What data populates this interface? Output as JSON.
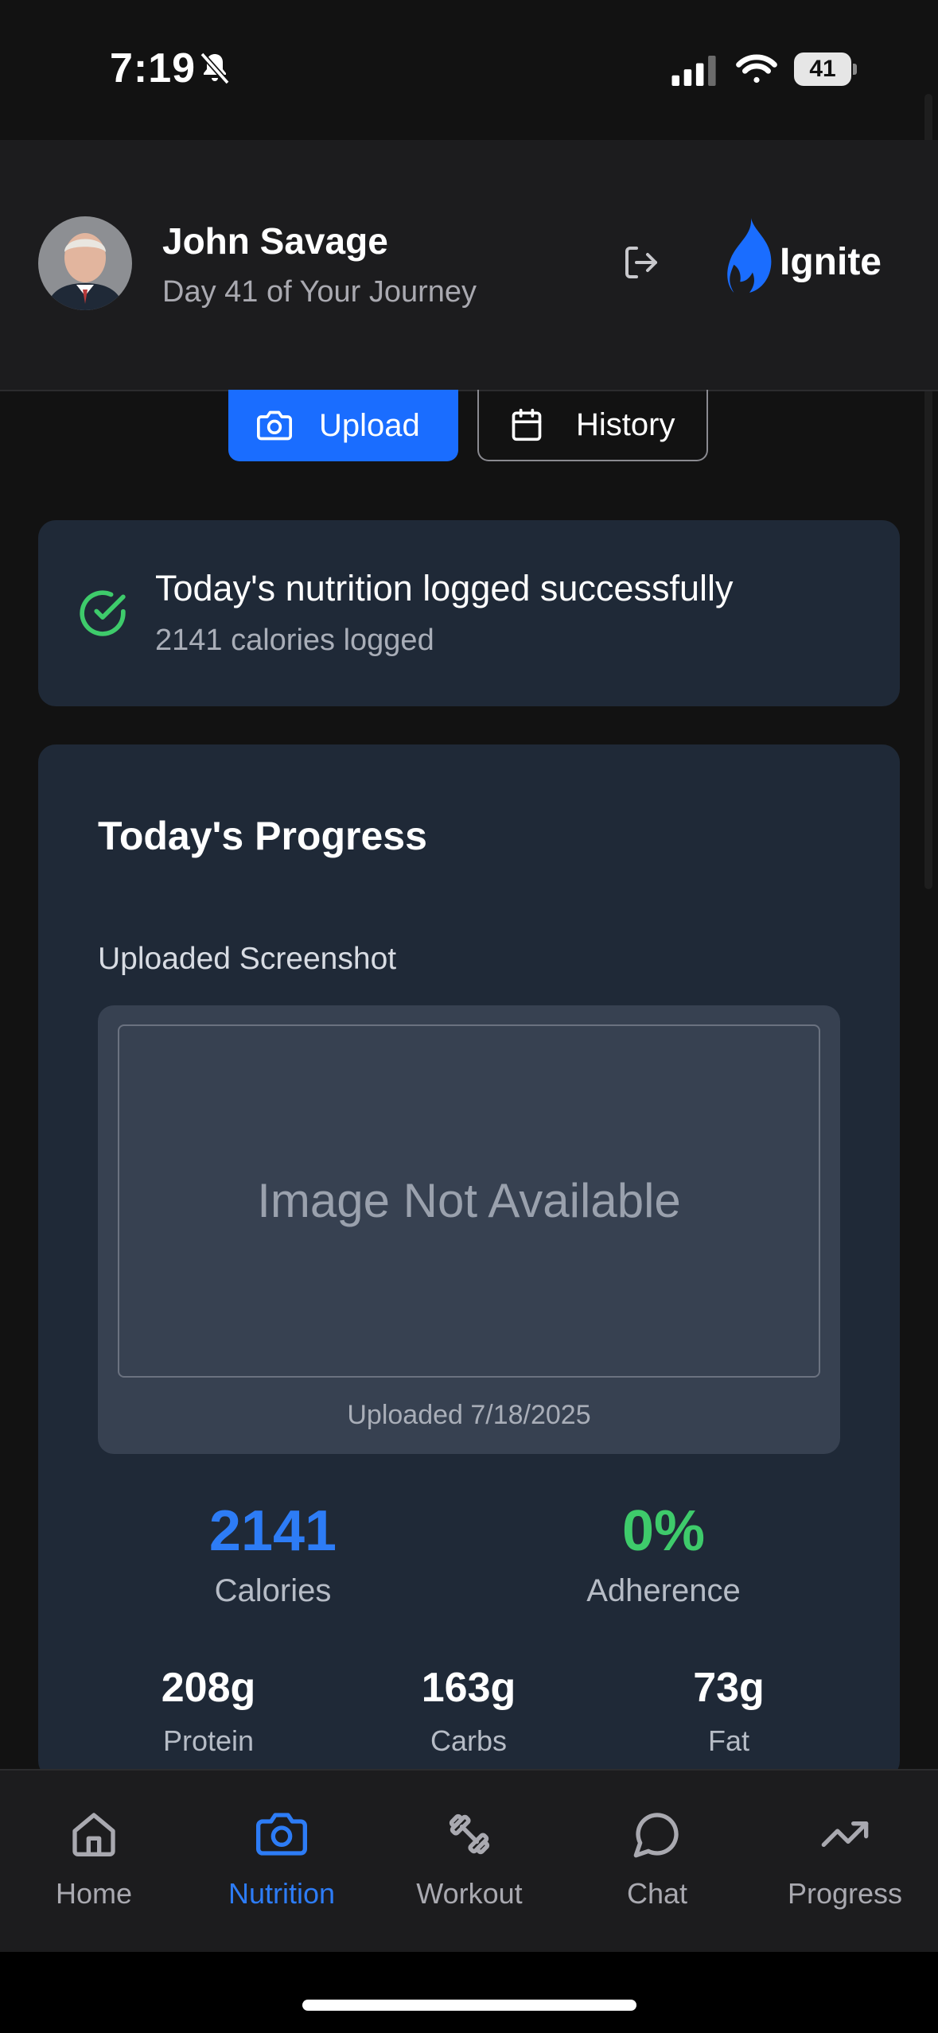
{
  "status_bar": {
    "time": "7:19",
    "battery": "41"
  },
  "header": {
    "user_name": "John Savage",
    "subtitle": "Day 41 of Your Journey",
    "brand": "Ignite",
    "brand_color": "#1a6dff"
  },
  "actions": {
    "upload_label": "Upload",
    "history_label": "History"
  },
  "success": {
    "title": "Today's nutrition logged successfully",
    "subtitle": "2141 calories logged",
    "color": "#3ecb6b"
  },
  "progress": {
    "title": "Today's Progress",
    "screenshot_label": "Uploaded Screenshot",
    "image_placeholder": "Image Not Available",
    "uploaded_date": "Uploaded 7/18/2025",
    "calories_value": "2141",
    "calories_label": "Calories",
    "adherence_value": "0%",
    "adherence_label": "Adherence",
    "macros": [
      {
        "value": "208g",
        "label": "Protein"
      },
      {
        "value": "163g",
        "label": "Carbs"
      },
      {
        "value": "73g",
        "label": "Fat"
      }
    ]
  },
  "nav": {
    "active": "Nutrition",
    "items": [
      {
        "label": "Home",
        "icon": "home-icon"
      },
      {
        "label": "Nutrition",
        "icon": "camera-icon"
      },
      {
        "label": "Workout",
        "icon": "dumbbell-icon"
      },
      {
        "label": "Chat",
        "icon": "chat-bubble-icon"
      },
      {
        "label": "Progress",
        "icon": "trending-up-icon"
      }
    ]
  }
}
